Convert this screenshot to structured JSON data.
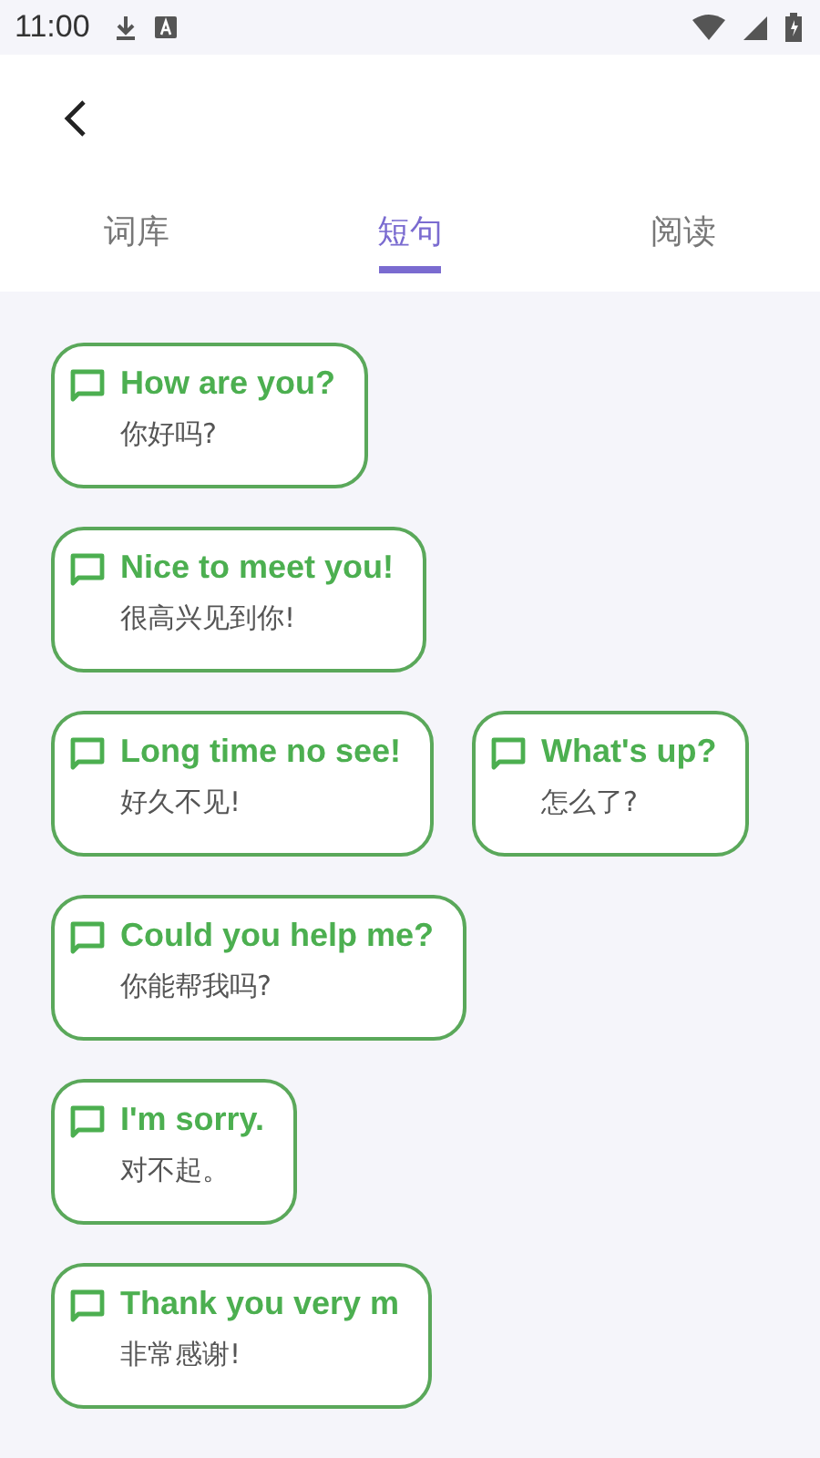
{
  "status_bar": {
    "time": "11:00"
  },
  "tabs": [
    {
      "label": "词库",
      "selected": false
    },
    {
      "label": "短句",
      "selected": true
    },
    {
      "label": "阅读",
      "selected": false
    }
  ],
  "phrase_rows": [
    [
      {
        "english": "How are you?",
        "chinese": "你好吗?"
      }
    ],
    [
      {
        "english": "Nice to meet you!",
        "chinese": "很高兴见到你!"
      }
    ],
    [
      {
        "english": "Long time no see!",
        "chinese": "好久不见!"
      },
      {
        "english": "What's up?",
        "chinese": "怎么了?"
      }
    ],
    [
      {
        "english": "Could you help me?",
        "chinese": "你能帮我吗?"
      }
    ],
    [
      {
        "english": "I'm sorry.",
        "chinese": "对不起。"
      }
    ],
    [
      {
        "english": "Thank you very m",
        "chinese": "非常感谢!"
      }
    ]
  ]
}
